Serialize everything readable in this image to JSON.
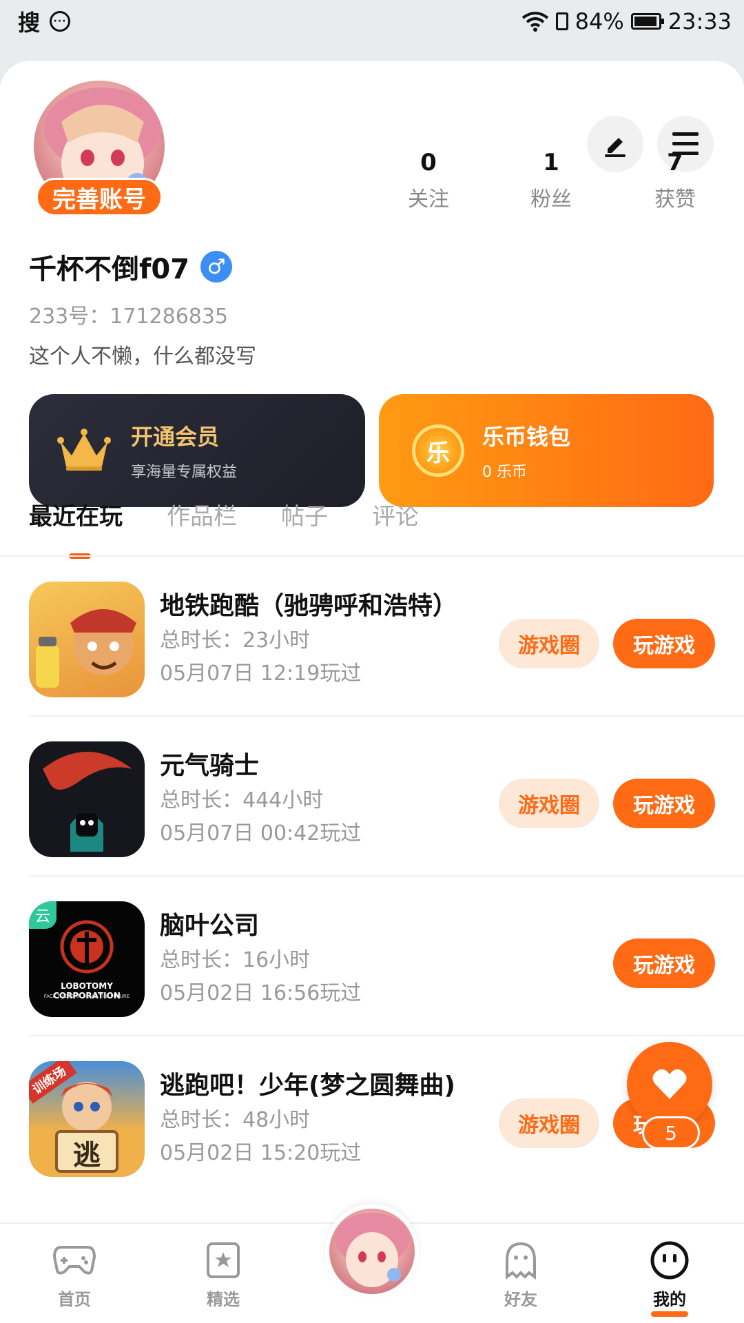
{
  "status_bar": {
    "left_char": "搜",
    "wifi": "wifi-icon",
    "battery_pct": "84%",
    "battery_level": 0.84,
    "time": "23:33"
  },
  "profile": {
    "complete_account_label": "完善账号",
    "stats": [
      {
        "value": "0",
        "label": "关注"
      },
      {
        "value": "1",
        "label": "粉丝"
      },
      {
        "value": "7",
        "label": "获赞"
      }
    ],
    "username": "千杯不倒f07",
    "gender_symbol": "♂",
    "uid": "233号：171286835",
    "bio": "这个人不懒，什么都没写"
  },
  "vip": {
    "title": "开通会员",
    "subtitle": "享海量专属权益"
  },
  "wallet": {
    "coin_char": "乐",
    "title": "乐币钱包",
    "subtitle": "0 乐币"
  },
  "tabs": [
    {
      "label": "最近在玩"
    },
    {
      "label": "作品栏"
    },
    {
      "label": "帖子"
    },
    {
      "label": "评论"
    }
  ],
  "games": [
    {
      "title": "地铁跑酷（驰骋呼和浩特）",
      "duration": "总时长：23小时",
      "last_played": "05月07日 12:19玩过",
      "circle_label": "游戏圈",
      "play_label": "玩游戏",
      "icon_colors": [
        "#f3b640",
        "#c2372c"
      ]
    },
    {
      "title": "元气骑士",
      "duration": "总时长：444小时",
      "last_played": "05月07日 00:42玩过",
      "circle_label": "游戏圈",
      "play_label": "玩游戏",
      "icon_colors": [
        "#1b1b22",
        "#cc3a2a"
      ]
    },
    {
      "title": "脑叶公司",
      "duration": "总时长：16小时",
      "last_played": "05月02日 16:56玩过",
      "circle_label": "",
      "play_label": "玩游戏",
      "icon_badge": "云",
      "icon_text": "LOBOTOMY CORPORATION",
      "icon_subtext": "FACE THE FEAR, MAKE THE FUTURE",
      "icon_colors": [
        "#0a0a0a",
        "#c8321e"
      ]
    },
    {
      "title": "逃跑吧！少年(梦之圆舞曲)",
      "duration": "总时长：48小时",
      "last_played": "05月02日 15:20玩过",
      "circle_label": "游戏圈",
      "play_label": "玩游戏",
      "icon_badge": "训练场",
      "icon_text": "逃",
      "icon_colors": [
        "#4a8fd8",
        "#f0b04a"
      ]
    }
  ],
  "like_fab": {
    "count": "5"
  },
  "bottom_nav": [
    {
      "label": "首页",
      "icon": "gamepad-icon"
    },
    {
      "label": "精选",
      "icon": "star-card-icon"
    },
    {
      "label": "",
      "icon": "avatar"
    },
    {
      "label": "好友",
      "icon": "ghost-icon"
    },
    {
      "label": "我的",
      "icon": "smiley-icon"
    }
  ],
  "colors": {
    "accent": "#ff6a14",
    "accent_light": "#fde8d8",
    "gender_blue": "#3b8ff4"
  }
}
